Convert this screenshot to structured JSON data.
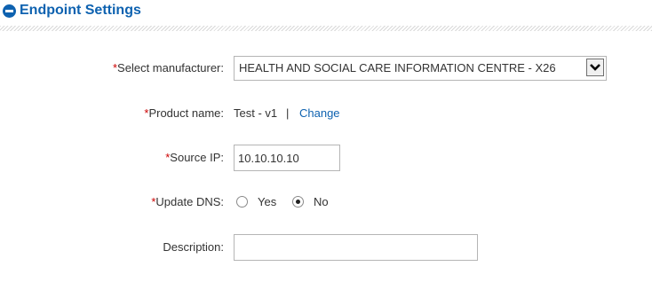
{
  "section": {
    "title": "Endpoint Settings"
  },
  "form": {
    "required_mark": "*",
    "manufacturer": {
      "label": "Select manufacturer:",
      "value": "HEALTH AND SOCIAL CARE INFORMATION CENTRE - X26"
    },
    "product": {
      "label": "Product name:",
      "value": "Test - v1",
      "separator": "|",
      "change_link": "Change"
    },
    "source_ip": {
      "label": "Source IP:",
      "value": "10.10.10.10"
    },
    "update_dns": {
      "label": "Update DNS:",
      "options": [
        {
          "label": "Yes",
          "selected": false
        },
        {
          "label": "No",
          "selected": true
        }
      ]
    },
    "description": {
      "label": "Description:",
      "value": ""
    }
  },
  "colors": {
    "accent": "#0e62b0",
    "required": "#cc0000"
  },
  "icons": {
    "collapse": "minus-circle-icon",
    "dropdown": "chevron-down-icon"
  }
}
